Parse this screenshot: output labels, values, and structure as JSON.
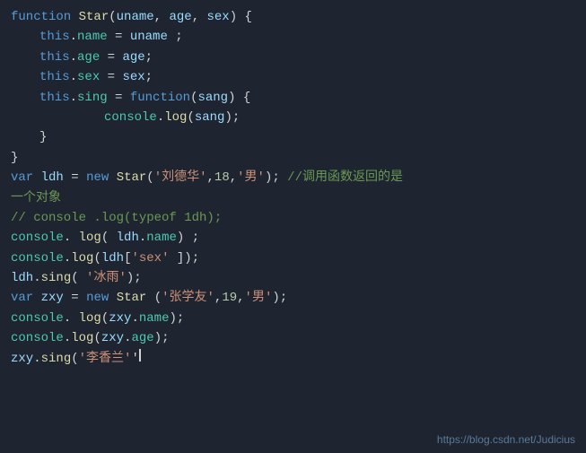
{
  "watermark": "https://blog.csdn.net/Judicius",
  "lines": [
    {
      "id": "line1"
    },
    {
      "id": "line2"
    },
    {
      "id": "line3"
    },
    {
      "id": "line4"
    },
    {
      "id": "line5"
    },
    {
      "id": "line6"
    },
    {
      "id": "line7"
    },
    {
      "id": "line8"
    },
    {
      "id": "line9"
    },
    {
      "id": "line10"
    },
    {
      "id": "line11"
    },
    {
      "id": "line12"
    },
    {
      "id": "line13"
    },
    {
      "id": "line14"
    },
    {
      "id": "line15"
    },
    {
      "id": "line16"
    },
    {
      "id": "line17"
    },
    {
      "id": "line18"
    }
  ]
}
